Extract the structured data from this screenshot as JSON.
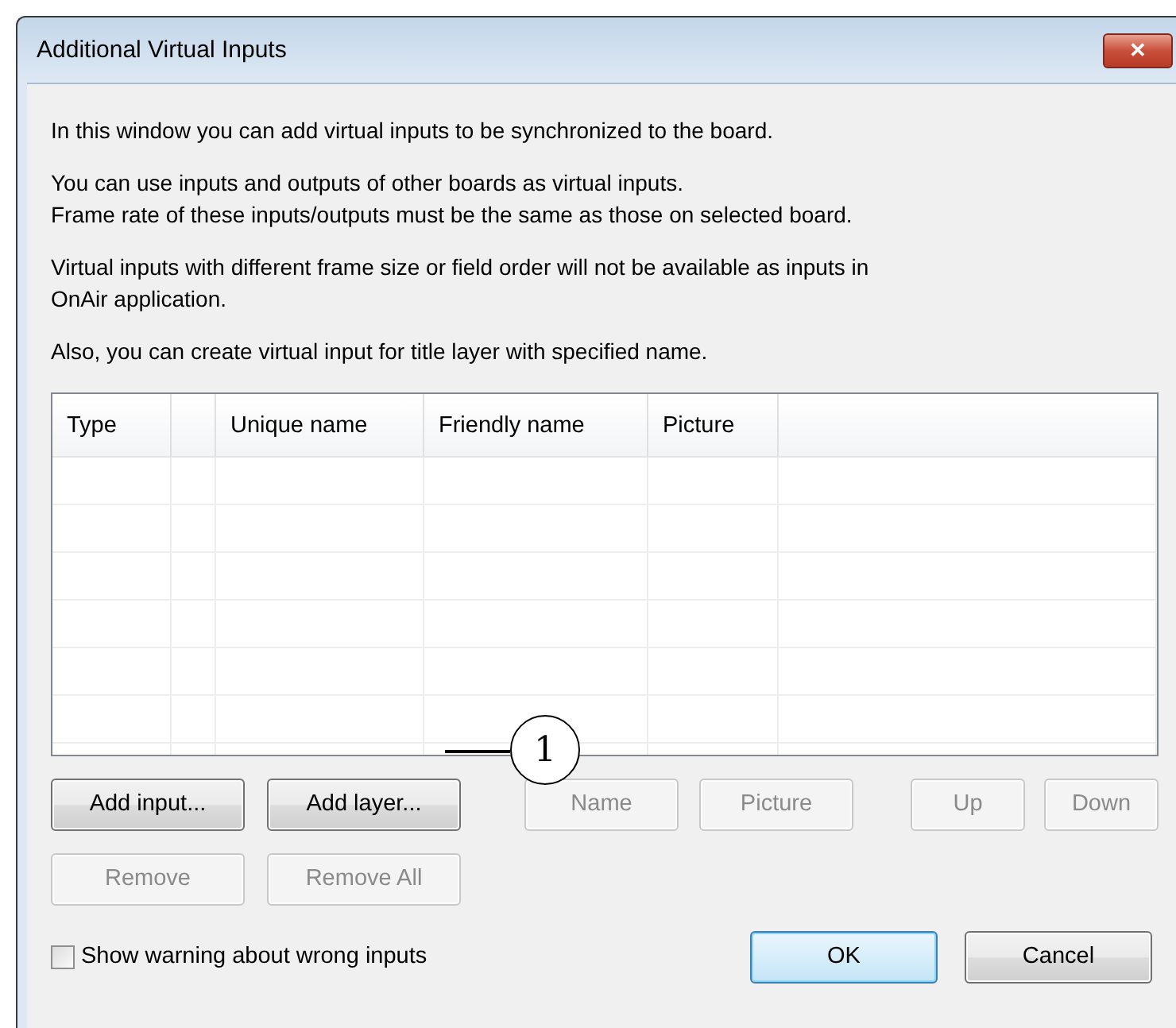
{
  "window": {
    "title": "Additional Virtual Inputs",
    "close_label": "✕"
  },
  "paragraphs": [
    "In this window you can add virtual inputs to be synchronized to the board.",
    "You can use inputs and outputs of other boards as virtual inputs.\nFrame rate of these inputs/outputs must be the same as those on selected board.",
    "Virtual inputs with different frame size or field order will not be available as inputs in\nOnAir application.",
    "Also, you can create virtual input for title layer with specified name."
  ],
  "table": {
    "columns": [
      "Type",
      "",
      "Unique name",
      "Friendly name",
      "Picture"
    ]
  },
  "buttons_row1": [
    {
      "label": "Add input...",
      "disabled": false
    },
    {
      "label": "Add layer...",
      "disabled": false
    },
    {
      "label": "Name",
      "disabled": true
    },
    {
      "label": "Picture",
      "disabled": true
    },
    {
      "label": "Up",
      "disabled": true
    },
    {
      "label": "Down",
      "disabled": true
    }
  ],
  "buttons_row2": [
    {
      "label": "Remove",
      "disabled": true
    },
    {
      "label": "Remove All",
      "disabled": true
    }
  ],
  "checkbox": {
    "label": "Show warning about wrong inputs",
    "checked": false
  },
  "dialog_buttons": [
    {
      "label": "OK",
      "default": true
    },
    {
      "label": "Cancel",
      "default": false
    }
  ],
  "callout": {
    "label": "1"
  }
}
